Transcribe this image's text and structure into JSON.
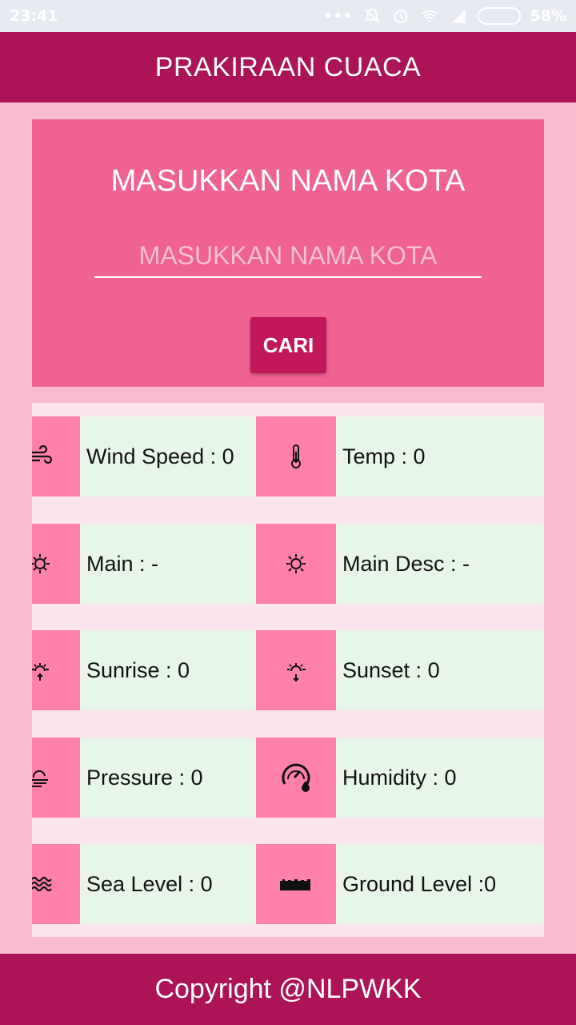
{
  "status_bar": {
    "time": "23:41",
    "battery_percent": "58%",
    "battery_level": 0.58
  },
  "app_bar": {
    "title": "PRAKIRAAN CUACA"
  },
  "search": {
    "title": "MASUKKAN NAMA KOTA",
    "input_placeholder": "MASUKKAN NAMA KOTA",
    "input_value": "",
    "button_label": "CARI"
  },
  "weather": {
    "wind_speed": "Wind Speed : 0",
    "temp": "Temp : 0",
    "main": "Main : -",
    "main_desc": "Main Desc : -",
    "sunrise": "Sunrise : 0",
    "sunset": "Sunset : 0",
    "pressure": "Pressure : 0",
    "humidity": "Humidity : 0",
    "sea_level": "Sea Level : 0",
    "ground_level": "Ground Level :0"
  },
  "footer": {
    "text": "Copyright @NLPWKK"
  },
  "colors": {
    "primary": "#ad1457",
    "card": "#f06292",
    "icon_bg": "#ff80ab",
    "cell_bg": "#e8f5e9",
    "page_bg": "#f8bbd0"
  }
}
